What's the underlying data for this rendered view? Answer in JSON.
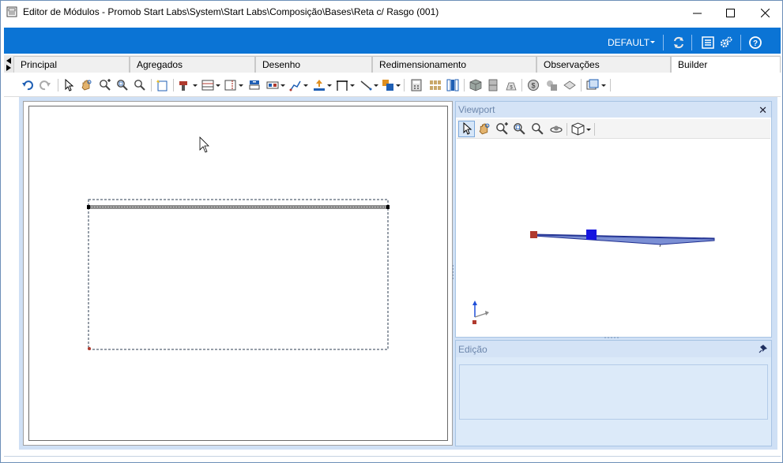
{
  "window": {
    "title": "Editor de Módulos - Promob Start Labs\\System\\Start Labs\\Composição\\Bases\\Reta c/ Rasgo (001)"
  },
  "ribbon": {
    "profile_label": "DEFAULT",
    "icons": [
      "refresh-icon",
      "properties-icon",
      "settings-icon",
      "help-icon"
    ]
  },
  "tabs": [
    {
      "label": "Principal"
    },
    {
      "label": "Agregados"
    },
    {
      "label": "Desenho"
    },
    {
      "label": "Redimensionamento"
    },
    {
      "label": "Observações"
    },
    {
      "label": "Builder"
    }
  ],
  "active_tab": "Builder",
  "viewport": {
    "title": "Viewport"
  },
  "edicao": {
    "title": "Edição"
  },
  "colors": {
    "accent_blue": "#0b74d5",
    "panel_bg": "#cfe0f5",
    "panel_header": "#d4e3f6",
    "panel_title_text": "#6d87ac"
  }
}
